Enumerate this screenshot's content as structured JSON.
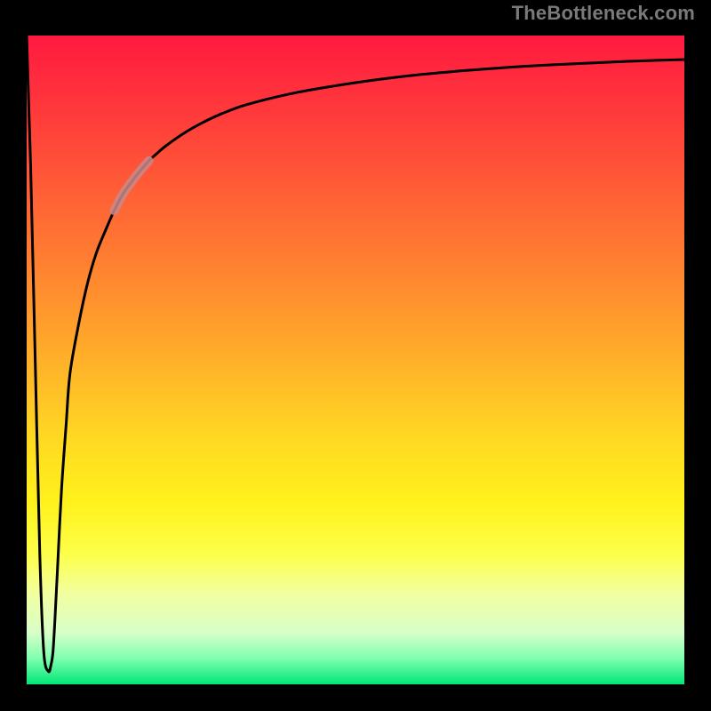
{
  "watermark": {
    "text": "TheBottleneck.com"
  },
  "chart_data": {
    "type": "line",
    "title": "",
    "xlabel": "",
    "ylabel": "",
    "xlim": [
      0,
      100
    ],
    "ylim": [
      0,
      100
    ],
    "series": [
      {
        "name": "curve",
        "x": [
          0.0,
          0.6,
          1.3,
          2.0,
          2.6,
          3.3,
          3.7,
          4.0,
          4.3,
          4.7,
          5.3,
          6.0,
          6.6,
          8.0,
          9.3,
          10.6,
          12.0,
          13.3,
          14.6,
          16.0,
          17.3,
          18.6,
          20.0,
          21.3,
          24.0,
          26.6,
          29.3,
          33.3,
          40.0,
          46.6,
          53.3,
          60.0,
          66.6,
          73.3,
          80.0,
          86.6,
          93.3,
          100.0
        ],
        "y": [
          100.0,
          80.0,
          50.0,
          20.0,
          5.0,
          2.0,
          3.0,
          5.0,
          10.0,
          18.0,
          30.0,
          40.0,
          48.0,
          56.0,
          62.0,
          66.5,
          70.0,
          73.0,
          75.5,
          77.5,
          79.2,
          80.7,
          82.0,
          83.1,
          85.0,
          86.5,
          87.8,
          89.3,
          91.0,
          92.2,
          93.2,
          94.0,
          94.6,
          95.1,
          95.5,
          95.8,
          96.1,
          96.3
        ]
      }
    ],
    "highlight_segment": {
      "x_from": 13.3,
      "x_to": 18.6
    },
    "background_gradient": {
      "top_color": "#ff1a40",
      "bottom_color": "#00e676"
    }
  }
}
